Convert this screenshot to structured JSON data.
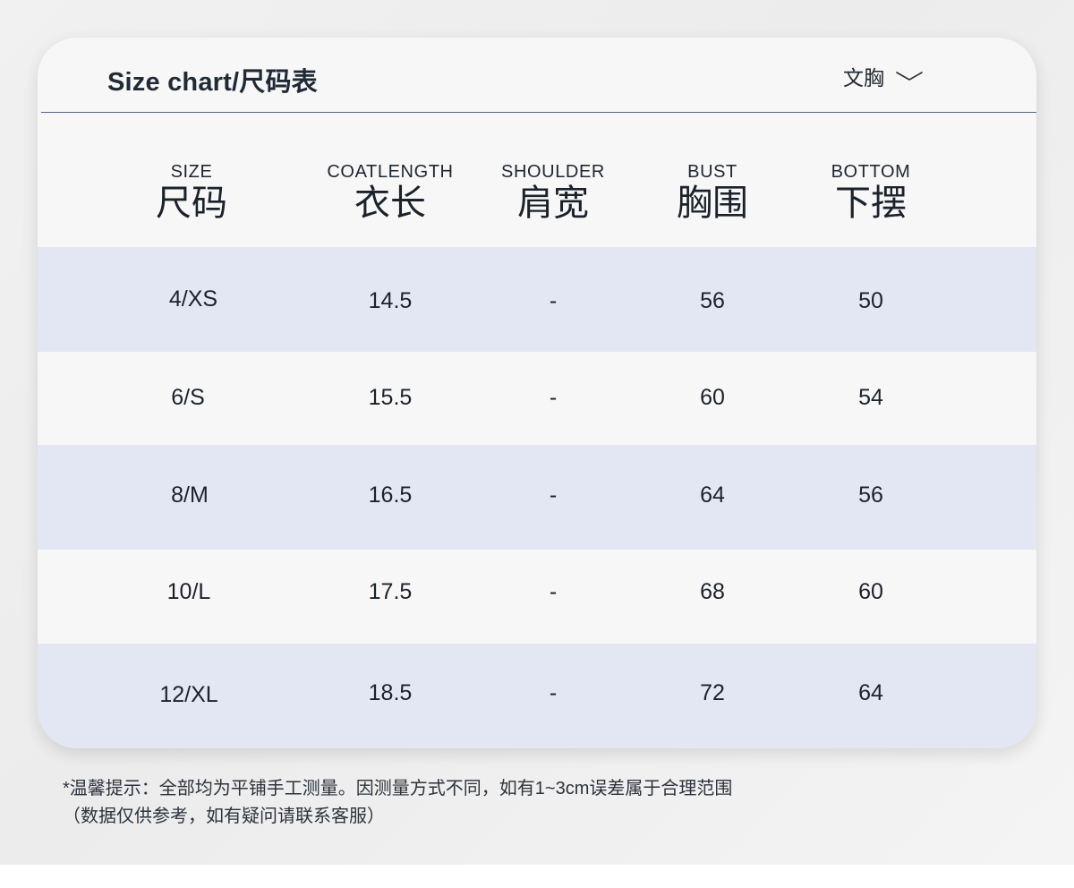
{
  "header": {
    "title": "Size chart/尺码表",
    "category": "文胸",
    "dropdown_icon": "chevron-down-icon"
  },
  "columns": [
    {
      "en": "SIZE",
      "zh": "尺码"
    },
    {
      "en": "COATLENGTH",
      "zh": "衣长"
    },
    {
      "en": "SHOULDER",
      "zh": "肩宽"
    },
    {
      "en": "BUST",
      "zh": "胸围"
    },
    {
      "en": "BOTTOM",
      "zh": "下摆"
    }
  ],
  "rows": [
    {
      "size": "4/XS",
      "coat_length": "14.5",
      "shoulder": "-",
      "bust": "56",
      "bottom": "50"
    },
    {
      "size": "6/S",
      "coat_length": "15.5",
      "shoulder": "-",
      "bust": "60",
      "bottom": "54"
    },
    {
      "size": "8/M",
      "coat_length": "16.5",
      "shoulder": "-",
      "bust": "64",
      "bottom": "56"
    },
    {
      "size": "10/L",
      "coat_length": "17.5",
      "shoulder": "-",
      "bust": "68",
      "bottom": "60"
    },
    {
      "size": "12/XL",
      "coat_length": "18.5",
      "shoulder": "-",
      "bust": "72",
      "bottom": "64"
    }
  ],
  "note": {
    "line1": "*温馨提示：全部均为平铺手工测量。因测量方式不同，如有1~3cm误差属于合理范围",
    "line2": "（数据仅供参考，如有疑问请联系客服）"
  },
  "colors": {
    "card_bg": "#f7f7f7",
    "row_shaded": "#e3e7f3",
    "header_rule": "#5a6480",
    "text": "#1b222b"
  }
}
